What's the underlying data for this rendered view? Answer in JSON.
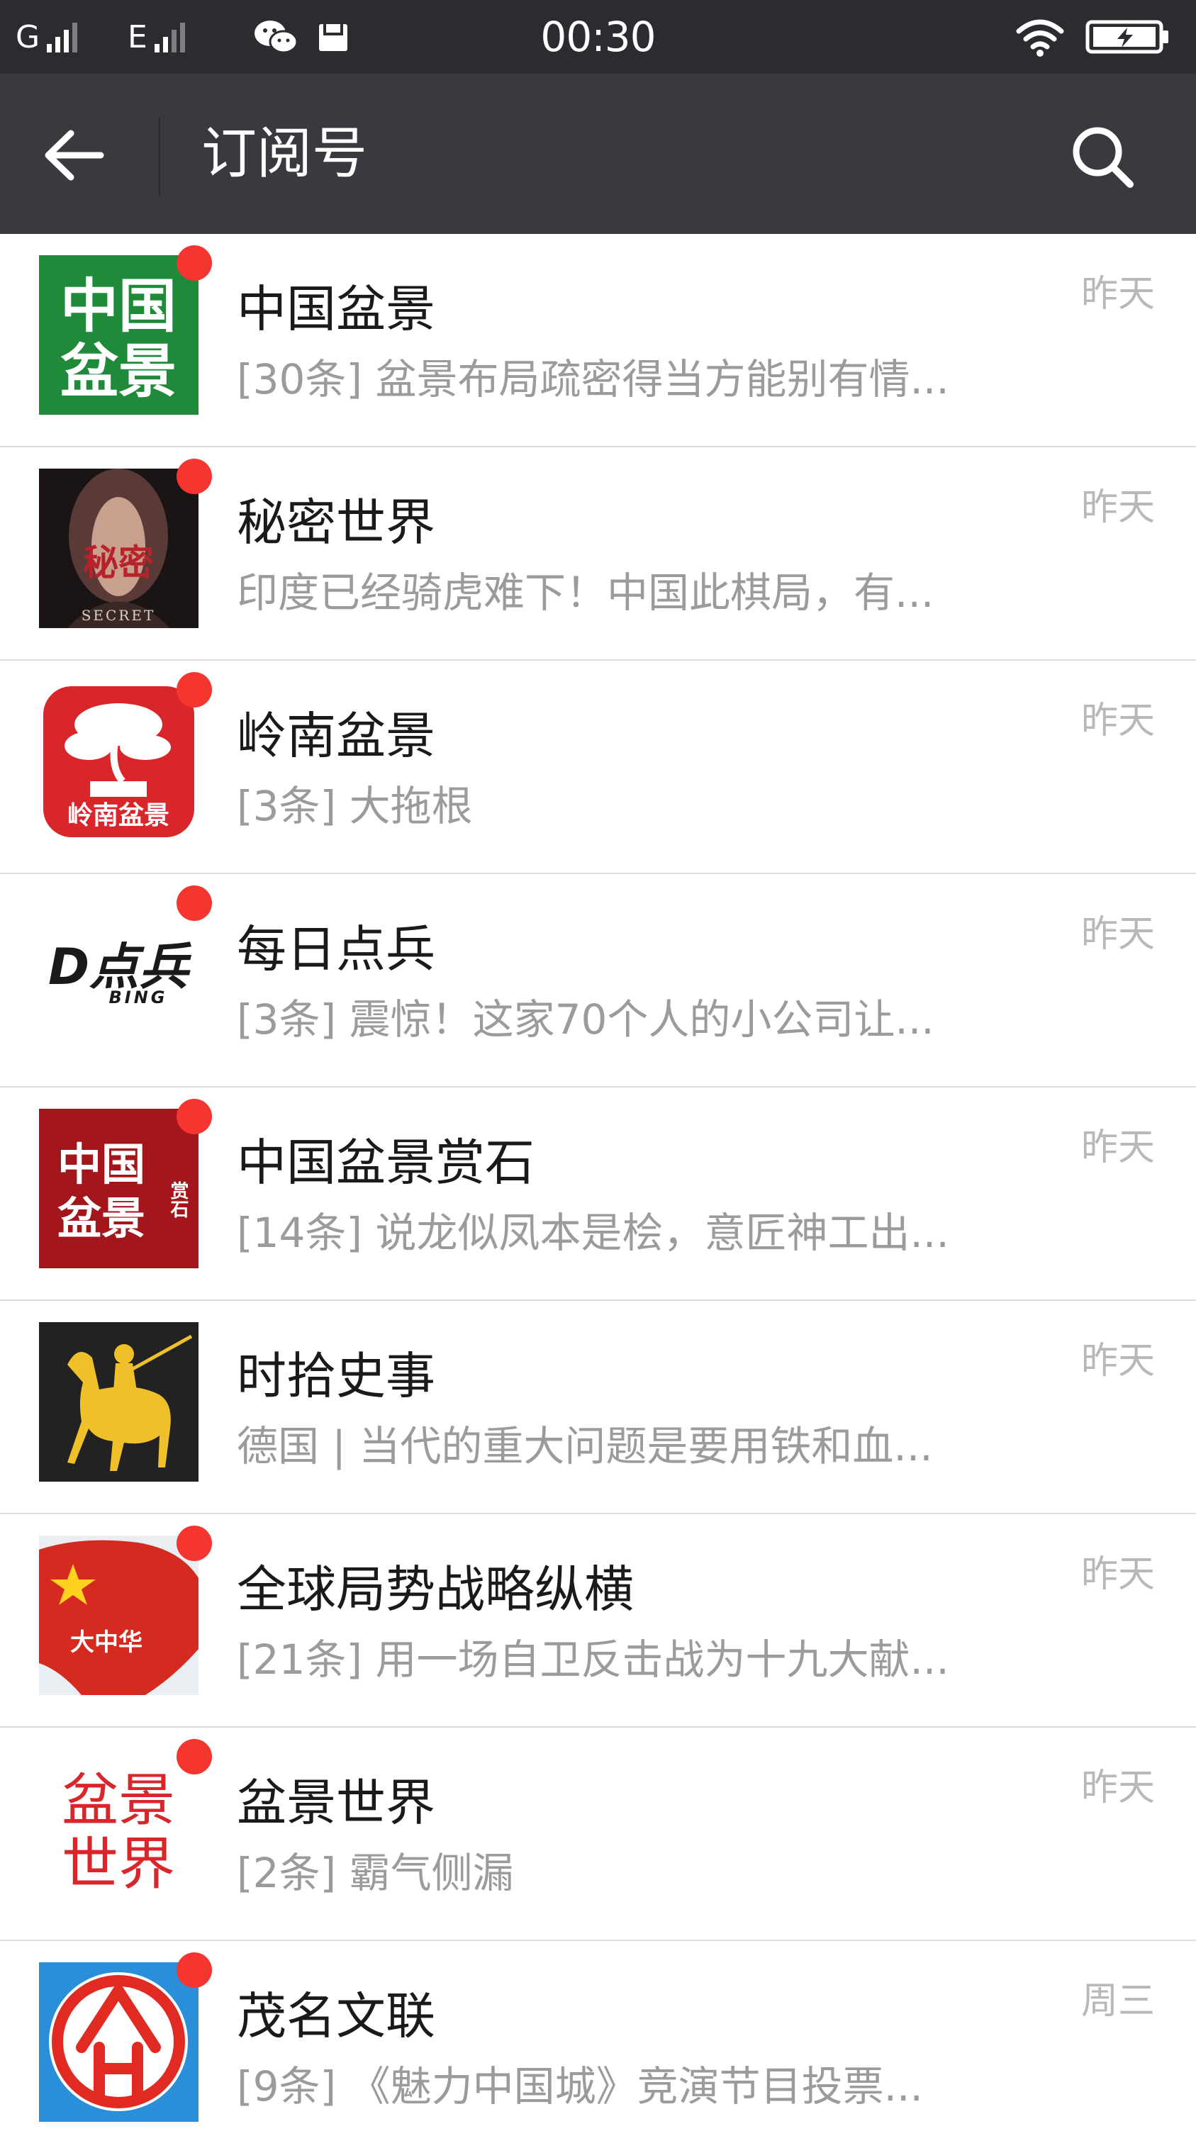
{
  "status_bar": {
    "network1": "G",
    "network2": "E",
    "clock": "00:30"
  },
  "app_bar": {
    "title": "订阅号"
  },
  "items": [
    {
      "name": "中国盆景",
      "preview": "[30条] 盆景布局疏密得当方能别有情...",
      "time": "昨天",
      "avatar_text": [
        "中国",
        "盆景"
      ],
      "avatar_colors": [
        "#1e8a3a",
        "#ffffff"
      ]
    },
    {
      "name": "秘密世界",
      "preview": "印度已经骑虎难下！中国此棋局，有...",
      "time": "昨天",
      "avatar_text": [
        "秘密",
        "SECRET"
      ],
      "avatar_colors": [
        "#1b1414",
        "#b8232b"
      ]
    },
    {
      "name": "岭南盆景",
      "preview": "[3条] 大拖根",
      "time": "昨天",
      "avatar_text": [
        "岭南盆景"
      ],
      "avatar_colors": [
        "#d8262b",
        "#ffffff"
      ]
    },
    {
      "name": "每日点兵",
      "preview": "[3条] 震惊！这家70个人的小公司让...",
      "time": "昨天",
      "avatar_text": [
        "D点兵",
        "BING"
      ],
      "avatar_colors": [
        "#ffffff",
        "#1a1a1a"
      ]
    },
    {
      "name": "中国盆景赏石",
      "preview": "[14条] 说龙似凤本是桧，意匠神工出...",
      "time": "昨天",
      "avatar_text": [
        "中国",
        "盆景",
        "赏石"
      ],
      "avatar_colors": [
        "#a3161b",
        "#ffffff"
      ]
    },
    {
      "name": "时拾史事",
      "preview": "德国 | 当代的重大问题是要用铁和血...",
      "time": "昨天",
      "avatar_text": [],
      "avatar_colors": [
        "#222222",
        "#f0c02a"
      ]
    },
    {
      "name": "全球局势战略纵横",
      "preview": "[21条] 用一场自卫反击战为十九大献...",
      "time": "昨天",
      "avatar_text": [
        "大中华"
      ],
      "avatar_colors": [
        "#e8eef2",
        "#d42a20"
      ]
    },
    {
      "name": "盆景世界",
      "preview": "[2条] 霸气侧漏",
      "time": "昨天",
      "avatar_text": [
        "盆景",
        "世界"
      ],
      "avatar_colors": [
        "#ffffff",
        "#d8262b"
      ]
    },
    {
      "name": "茂名文联",
      "preview": "[9条] 《魅力中国城》竞演节目投票...",
      "time": "周三",
      "avatar_text": [],
      "avatar_colors": [
        "#2a8fd8",
        "#e02a22"
      ]
    }
  ],
  "unread": [
    true,
    true,
    true,
    true,
    true,
    false,
    true,
    true,
    true
  ],
  "icons": {
    "back": "arrow-left-icon",
    "search": "magnifier-icon",
    "wechat": "wechat-icon",
    "notification": "message-icon",
    "wifi": "wifi-icon",
    "battery": "battery-charging-icon"
  },
  "colors": {
    "app_bar": "#393a3f",
    "status_bar": "#2a2c30",
    "badge": "#f43530",
    "name": "#1a1a1a",
    "preview": "#9b9b9b",
    "time": "#b8b8b8"
  }
}
